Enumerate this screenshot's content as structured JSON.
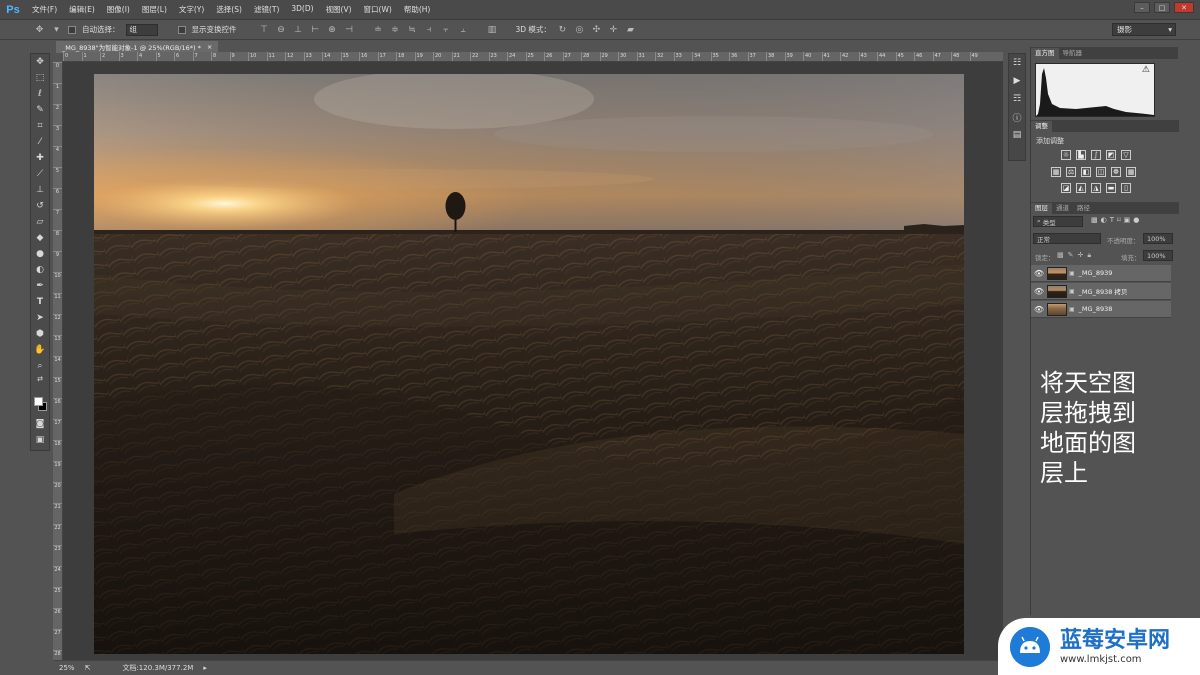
{
  "app": {
    "logo": "Ps",
    "menu": [
      "文件(F)",
      "编辑(E)",
      "图像(I)",
      "图层(L)",
      "文字(Y)",
      "选择(S)",
      "滤镜(T)",
      "3D(D)",
      "视图(V)",
      "窗口(W)",
      "帮助(H)"
    ],
    "window_controls": [
      "–",
      "□",
      "✕"
    ]
  },
  "options_bar": {
    "auto_select_label": "自动选择：",
    "auto_select_value": "组",
    "show_transform_label": "显示变换控件",
    "mode_3d_label": "3D 模式：",
    "workspace": "摄影"
  },
  "document": {
    "tab_title": "_MG_8938\"为智能对象-1 @ 25%(RGB/16*) *",
    "tab_close": "×",
    "ruler_h": [
      "0",
      "1",
      "2",
      "3",
      "4",
      "5",
      "6",
      "7",
      "8",
      "9",
      "10",
      "11",
      "12",
      "13",
      "14",
      "15",
      "16",
      "17",
      "18",
      "19",
      "20",
      "21",
      "22",
      "23",
      "24",
      "25",
      "26",
      "27",
      "28",
      "29",
      "30",
      "31",
      "32",
      "33",
      "34",
      "35",
      "36",
      "37",
      "38",
      "39",
      "40",
      "41",
      "42",
      "43",
      "44",
      "45",
      "46",
      "47",
      "48",
      "49"
    ],
    "ruler_v": [
      "0",
      "1",
      "2",
      "3",
      "4",
      "5",
      "6",
      "7",
      "8",
      "9",
      "10",
      "11",
      "12",
      "13",
      "14",
      "15",
      "16",
      "17",
      "18",
      "19",
      "20",
      "21",
      "22",
      "23",
      "24",
      "25",
      "26",
      "27",
      "28"
    ]
  },
  "status": {
    "zoom": "25%",
    "doc_info": "文档:120.3M/377.2M"
  },
  "panels": {
    "histogram_tabs": [
      "直方图",
      "导航器"
    ],
    "warning": "⚠",
    "adjust_tab": "调整",
    "adjust_title": "添加调整",
    "layers_tabs": [
      "图层",
      "通道",
      "路径"
    ],
    "filter_kind": "类型",
    "blend_mode": "正常",
    "opacity_label": "不透明度：",
    "opacity_value": "100%",
    "lock_label": "锁定：",
    "fill_label": "填充：",
    "fill_value": "100%",
    "layers": [
      {
        "name": "_MG_8939"
      },
      {
        "name": "_MG_8938 拷贝"
      },
      {
        "name": "_MG_8938"
      }
    ]
  },
  "annotation": [
    "将天空图",
    "层拖拽到",
    "地面的图",
    "层上"
  ],
  "watermark": {
    "name": "蓝莓安卓网",
    "url": "www.lmkjst.com"
  }
}
